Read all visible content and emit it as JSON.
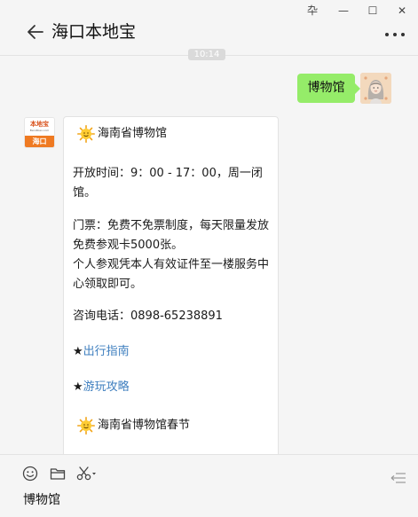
{
  "window": {
    "controls": {
      "pin": "卆",
      "minimize": "—",
      "maximize": "☐",
      "close": "✕"
    }
  },
  "chat": {
    "title": "海口本地宝",
    "timestamp": "10:14"
  },
  "messages": {
    "outgoing": {
      "text": "博物馆"
    },
    "account_avatar": {
      "brand": "本地宝",
      "site": "Bendibao.com",
      "city": "海口"
    },
    "card": {
      "heading": "海南省博物馆",
      "hours": "开放时间：9：00 - 17：00，周一闭馆。",
      "tickets": "门票：免费不免票制度，每天限量发放免费参观卡5000张。",
      "ticket_note": "个人参观凭本人有效证件至一楼服务中心领取即可。",
      "phone": "咨询电话：0898-65238891",
      "star": "★",
      "link1": "出行指南",
      "link2": "游玩攻略",
      "heading2": "海南省博物馆春节"
    }
  },
  "input": {
    "draft_text": "博物馆"
  },
  "colors": {
    "accent_green": "#95ec69",
    "link_blue": "#3f7fbf",
    "brand_orange": "#ef7a22"
  },
  "icons": {
    "back": "back-arrow-icon",
    "more": "more-icon",
    "emoji": "emoji-icon",
    "folder": "folder-icon",
    "scissors": "scissors-icon",
    "send": "send-list-icon",
    "sun": "sun-emoji-icon"
  }
}
